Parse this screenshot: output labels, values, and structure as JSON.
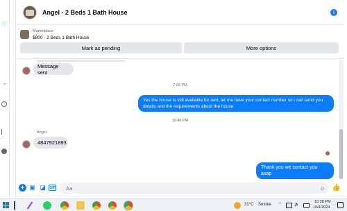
{
  "header": {
    "title": "Angel · 2 Beds 1 Bath House",
    "info_icon": "info-icon"
  },
  "listing": {
    "source": "Marketplace",
    "summary": "$800 · 2 Beds 1 Bath House",
    "mark_pending_label": "Mark as pending",
    "more_options_label": "More options"
  },
  "messages": [
    {
      "direction": "incoming",
      "text": "Message sent"
    },
    {
      "timestamp": "7:03 PM"
    },
    {
      "direction": "outgoing",
      "text": "Yes the house is still available for rent, let me have your contact number so i can send you details and the requirements about the house"
    },
    {
      "timestamp": "10:46 PM"
    },
    {
      "direction": "incoming",
      "sender": "Angel",
      "text": "4847921893"
    },
    {
      "direction": "outgoing",
      "text": "Thank you we contact you asap",
      "status": "Sent"
    }
  ],
  "composer": {
    "placeholder": "Aa"
  },
  "taskbar": {
    "weather_temp": "31°C",
    "weather_desc": "Smoke",
    "time": "10:38 PM",
    "date": "10/4/2024"
  },
  "colors": {
    "accent": "#0a7cff",
    "incoming_bubble": "#e4e6eb",
    "secondary_text": "#65676b"
  }
}
